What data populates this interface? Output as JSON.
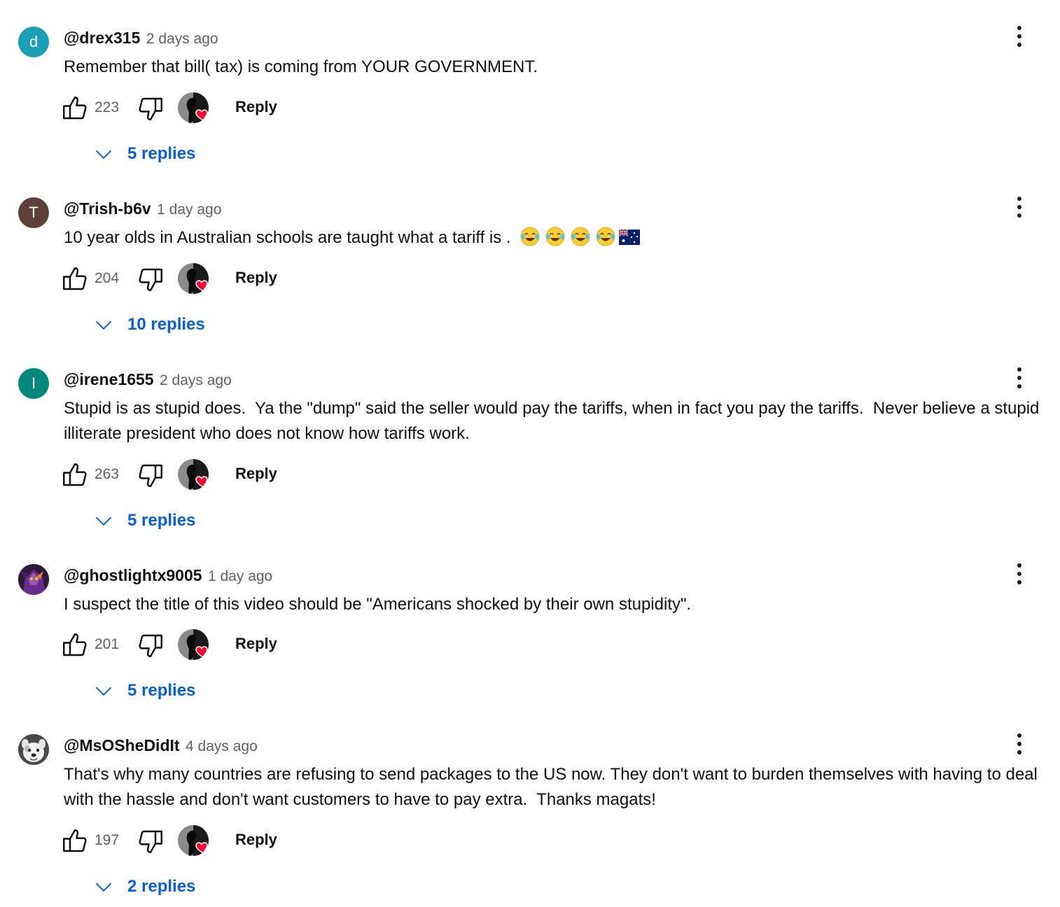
{
  "comments": [
    {
      "author": "@drex315",
      "time": "2 days ago",
      "avatar_letter": "d",
      "avatar_color": "#1a9fb4",
      "text": "Remember that bill( tax) is coming from YOUR GOVERNMENT.",
      "likes": "223",
      "reply_label": "Reply",
      "replies_label": "5 replies"
    },
    {
      "author": "@Trish-b6v",
      "time": "1 day ago",
      "avatar_letter": "T",
      "avatar_color": "#5d4037",
      "text": "10 year olds in Australian schools are taught what a tariff is . ",
      "emojis": [
        "face-with-tears-of-joy",
        "face-with-tears-of-joy",
        "face-with-tears-of-joy",
        "face-with-tears-of-joy",
        "flag-australia"
      ],
      "likes": "204",
      "reply_label": "Reply",
      "replies_label": "10 replies"
    },
    {
      "author": "@irene1655",
      "time": "2 days ago",
      "avatar_letter": "I",
      "avatar_color": "#00897b",
      "text": "Stupid is as stupid does.  Ya the \"dump\" said the seller would pay the tariffs, when in fact you pay the tariffs.  Never believe a stupid illiterate president who does not know how tariffs work.",
      "likes": "263",
      "reply_label": "Reply",
      "replies_label": "5 replies"
    },
    {
      "author": "@ghostlightx9005",
      "time": "1 day ago",
      "avatar_image": "purple-character-avatar",
      "text": "I suspect the title of this video should be \"Americans shocked by their own stupidity\".",
      "likes": "201",
      "reply_label": "Reply",
      "replies_label": "5 replies"
    },
    {
      "author": "@MsOSheDidIt",
      "time": "4 days ago",
      "avatar_image": "dog-photo-avatar",
      "text": "That's why many countries are refusing to send packages to the US now. They don't want to burden themselves with having to deal with the hassle and don't want customers to have to pay extra.  Thanks magats!",
      "likes": "197",
      "reply_label": "Reply",
      "replies_label": "2 replies"
    }
  ],
  "colors": {
    "link_blue": "#065fd4",
    "secondary_text": "#606060",
    "heart_red": "#ff0033"
  }
}
